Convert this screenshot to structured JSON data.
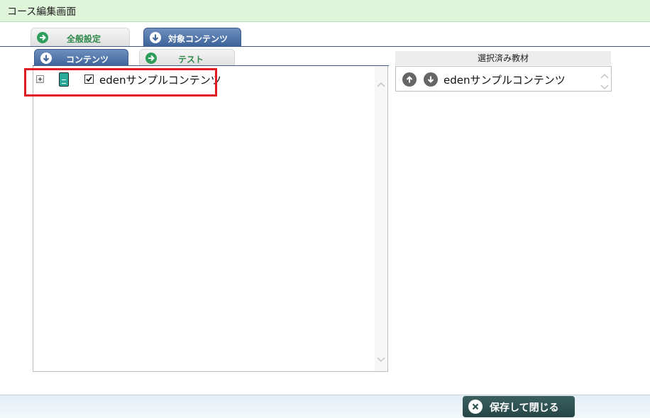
{
  "header": {
    "title": "コース編集画面"
  },
  "tabs": {
    "general": {
      "label": "全般設定",
      "icon": "arrow-right-icon"
    },
    "target_contents": {
      "label": "対象コンテンツ",
      "icon": "arrow-down-icon",
      "active": true
    }
  },
  "subtabs": {
    "contents": {
      "label": "コンテンツ",
      "icon": "arrow-down-icon",
      "active": true
    },
    "test": {
      "label": "テスト",
      "icon": "arrow-right-icon"
    }
  },
  "tree": {
    "items": [
      {
        "label": "edenサンプルコンテンツ",
        "checked": true,
        "icon": "book-icon",
        "expander": "plus"
      }
    ]
  },
  "selected": {
    "header": "選択済み教材",
    "items": [
      {
        "label": "edenサンプルコンテンツ"
      }
    ]
  },
  "footer": {
    "save_close_label": "保存して閉じる"
  },
  "colors": {
    "header_bg": "#dff5d9",
    "active_tab": "#3e649a",
    "inactive_tab_text": "#2f8a4c",
    "highlight": "#e01b24",
    "save_button": "#2f5050"
  }
}
